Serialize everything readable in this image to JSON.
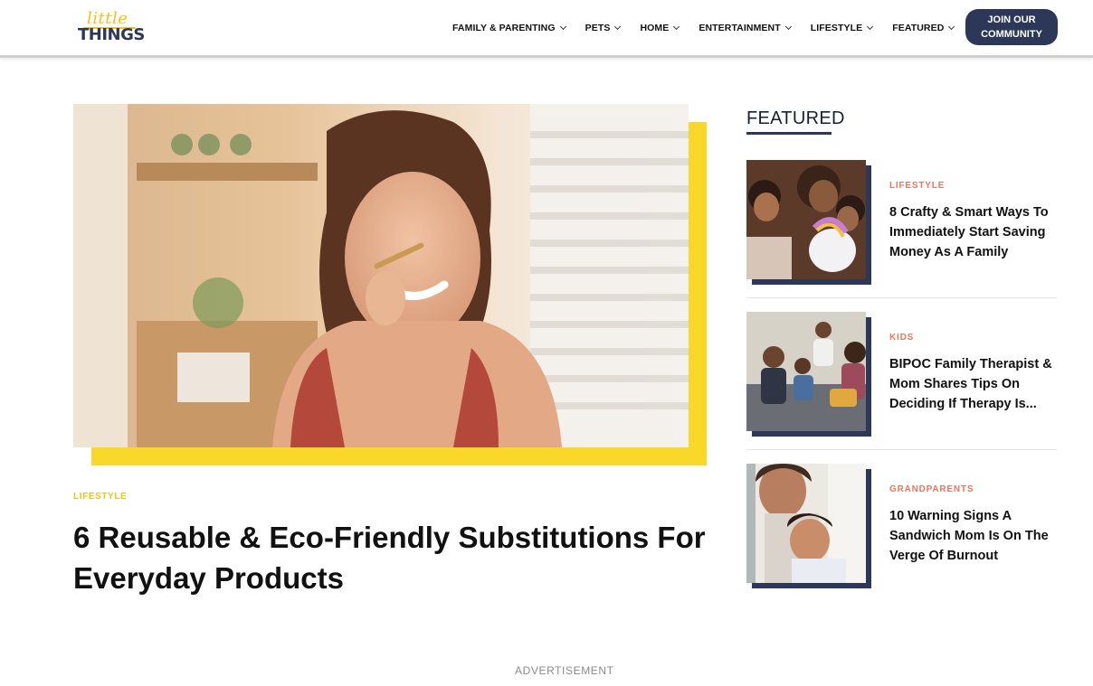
{
  "logo": {
    "top": "little",
    "bottom": "THINGS"
  },
  "nav": {
    "items": [
      {
        "label": "FAMILY & PARENTING"
      },
      {
        "label": "PETS"
      },
      {
        "label": "HOME"
      },
      {
        "label": "ENTERTAINMENT"
      },
      {
        "label": "LIFESTYLE"
      },
      {
        "label": "FEATURED"
      }
    ],
    "join_line1": "JOIN OUR",
    "join_line2": "COMMUNITY"
  },
  "hero": {
    "category": "LIFESTYLE",
    "title": "6 Reusable & Eco-Friendly Substitutions For Everyday Products"
  },
  "featured": {
    "heading": "FEATURED",
    "items": [
      {
        "category": "LIFESTYLE",
        "title": "8 Crafty & Smart Ways To Immediately Start Saving Money As A Family"
      },
      {
        "category": "KIDS",
        "title": "BIPOC Family Therapist & Mom Shares Tips On Deciding If Therapy Is..."
      },
      {
        "category": "GRANDPARENTS",
        "title": "10 Warning Signs A Sandwich Mom Is On The Verge Of Burnout"
      }
    ]
  },
  "advertisement": "ADVERTISEMENT",
  "colors": {
    "brand_navy": "#2d3858",
    "brand_yellow": "#f9d829",
    "category_coral": "#e8775e"
  }
}
